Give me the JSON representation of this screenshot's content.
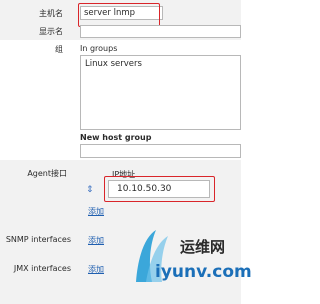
{
  "form": {
    "host_name_label": "主机名",
    "host_name_value": "server lnmp",
    "visible_name_label": "显示名",
    "visible_name_value": "",
    "groups_label": "组",
    "in_groups_label": "In groups",
    "groups": [
      "Linux servers"
    ],
    "new_group_label": "New host group",
    "new_group_value": ""
  },
  "interfaces": {
    "agent_label": "Agent接口",
    "ip_header": "IP地址",
    "agent_ip": "10.10.50.30",
    "agent_add": "添加",
    "snmp_label": "SNMP interfaces",
    "snmp_add": "添加",
    "jmx_label": "JMX interfaces",
    "jmx_add": "添加"
  },
  "watermark": {
    "brand_cn": "运维网",
    "site": "iyunv.com"
  },
  "colors": {
    "highlight": "#d9252a",
    "link": "#1f5fb0",
    "band": "#f2f2f2"
  }
}
